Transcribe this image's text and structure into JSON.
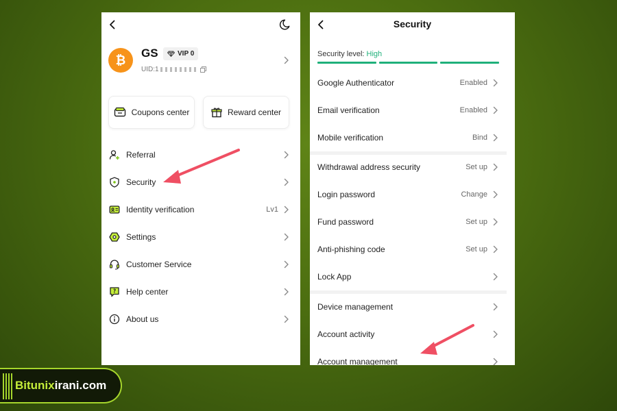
{
  "profile": {
    "name": "GS",
    "vip_label": "VIP 0",
    "uid_prefix": "UID:1"
  },
  "cards": {
    "coupons_label": "Coupons center",
    "reward_label": "Reward center"
  },
  "menu": {
    "items": [
      {
        "label": "Referral",
        "value": ""
      },
      {
        "label": "Security",
        "value": ""
      },
      {
        "label": "Identity verification",
        "value": "Lv1"
      },
      {
        "label": "Settings",
        "value": ""
      },
      {
        "label": "Customer Service",
        "value": ""
      },
      {
        "label": "Help center",
        "value": ""
      },
      {
        "label": "About us",
        "value": ""
      }
    ]
  },
  "security": {
    "title": "Security",
    "level_label": "Security level:",
    "level_value": "High",
    "rows": [
      {
        "label": "Google Authenticator",
        "value": "Enabled"
      },
      {
        "label": "Email verification",
        "value": "Enabled"
      },
      {
        "label": "Mobile verification",
        "value": "Bind"
      },
      {
        "label": "Withdrawal address security",
        "value": "Set up"
      },
      {
        "label": "Login password",
        "value": "Change"
      },
      {
        "label": "Fund password",
        "value": "Set up"
      },
      {
        "label": "Anti-phishing code",
        "value": "Set up"
      },
      {
        "label": "Lock App",
        "value": ""
      },
      {
        "label": "Device management",
        "value": ""
      },
      {
        "label": "Account activity",
        "value": ""
      },
      {
        "label": "Account management",
        "value": ""
      }
    ]
  },
  "brand": {
    "part1": "Bitunix",
    "part2": "irani.com"
  },
  "colors": {
    "accent_green": "#1fb07a",
    "annotation_arrow": "#ef4f63",
    "btc_orange": "#f7931a",
    "brand_lime": "#a6d62c"
  }
}
